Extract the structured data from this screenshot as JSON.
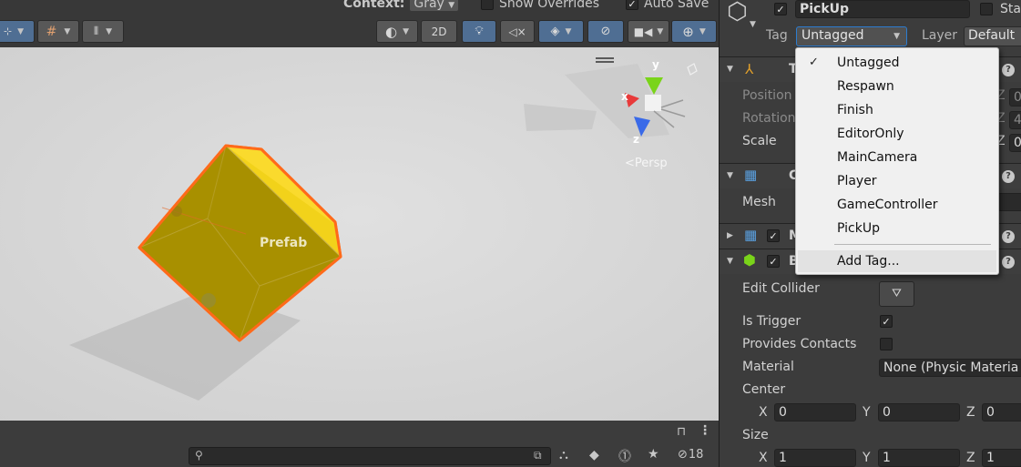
{
  "scene": {
    "toolbar": {
      "context_label": "Context:",
      "context_value": "Gray",
      "show_overrides_label": "Show Overrides",
      "auto_save_label": "Auto Save",
      "auto_save_checked": true,
      "btn_2d_label": "2D"
    },
    "viewport": {
      "prefab_label": "Prefab",
      "persp_label": "<Persp",
      "gizmo_y": "y",
      "gizmo_x": "x",
      "gizmo_z": "z"
    },
    "status": {
      "hidden_count": "18"
    }
  },
  "inspector": {
    "object_name": "PickUp",
    "static_label": "Sta",
    "tag_label": "Tag",
    "tag_value": "Untagged",
    "layer_label": "Layer",
    "layer_value": "Default",
    "transform_initial": "T",
    "position_label": "Position",
    "rotation_label": "Rotation",
    "scale_label": "Scale",
    "pos_axis": "Z",
    "pos_val": "0",
    "rot_axis": "Z",
    "rot_val": "4",
    "scale_axis": "Z",
    "scale_val": "0",
    "meshfilter_initial": "C",
    "mesh_label": "Mesh",
    "meshrenderer_initial": "M",
    "boxcollider_initial": "B",
    "edit_collider_label": "Edit Collider",
    "is_trigger_label": "Is Trigger",
    "provides_contacts_label": "Provides Contacts",
    "material_label": "Material",
    "material_value": "None (Physic Materia",
    "center_label": "Center",
    "center": {
      "x_label": "X",
      "x": "0",
      "y_label": "Y",
      "y": "0",
      "z_label": "Z",
      "z": "0"
    },
    "size_label": "Size",
    "size": {
      "x_label": "X",
      "x": "1",
      "y_label": "Y",
      "y": "1",
      "z_label": "Z",
      "z": "1"
    }
  },
  "tag_menu": {
    "items": [
      "Untagged",
      "Respawn",
      "Finish",
      "EditorOnly",
      "MainCamera",
      "Player",
      "GameController",
      "PickUp"
    ],
    "checked_item": "Untagged",
    "add_tag_label": "Add Tag..."
  },
  "colors": {
    "prefab_cube": "#a89000",
    "selection_outline": "#ff6a1a",
    "gizmo_y": "#7ad41a",
    "gizmo_x": "#e83a3a",
    "gizmo_z": "#3a6ae8",
    "collider_icon": "#7ad41a",
    "pressed_button": "#4f6e93"
  },
  "icons": [
    "grid-icon",
    "snap-icon",
    "shading-mode-icon",
    "light-icon",
    "audio-mute-icon",
    "effects-icon",
    "hidden-visibility-icon",
    "camera-icon",
    "gizmos-icon",
    "search-icon",
    "lock-icon",
    "kebab-menu-icon",
    "help-icon",
    "cube-icon",
    "transform-icon",
    "mesh-icon",
    "collider-icon",
    "checkmark-icon"
  ]
}
